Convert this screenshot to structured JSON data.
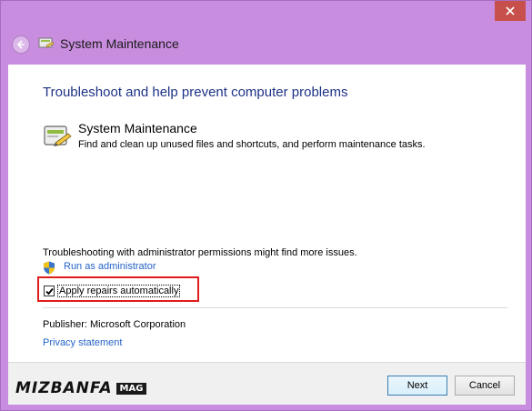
{
  "window": {
    "title": "System Maintenance",
    "close_icon": "close-icon",
    "back_icon": "back-arrow-icon"
  },
  "main": {
    "heading": "Troubleshoot and help prevent computer problems",
    "task": {
      "title": "System Maintenance",
      "description": "Find and clean up unused files and shortcuts, and perform maintenance tasks.",
      "icon": "maintenance-icon"
    },
    "admin_note": "Troubleshooting with administrator permissions might find more issues.",
    "run_as_admin": "Run as administrator",
    "apply_repairs": {
      "label": "Apply repairs automatically",
      "checked": true
    },
    "publisher_label": "Publisher:",
    "publisher_value": "Microsoft Corporation",
    "privacy": "Privacy statement"
  },
  "footer": {
    "next_label": "Next",
    "cancel_label": "Cancel"
  },
  "watermark": {
    "brand": "MIZBANFA",
    "tag": "MAG"
  },
  "colors": {
    "frame": "#c98ddf",
    "heading": "#1e3287",
    "link": "#2563c7",
    "highlight": "#e01c1c",
    "close": "#c7504c"
  }
}
